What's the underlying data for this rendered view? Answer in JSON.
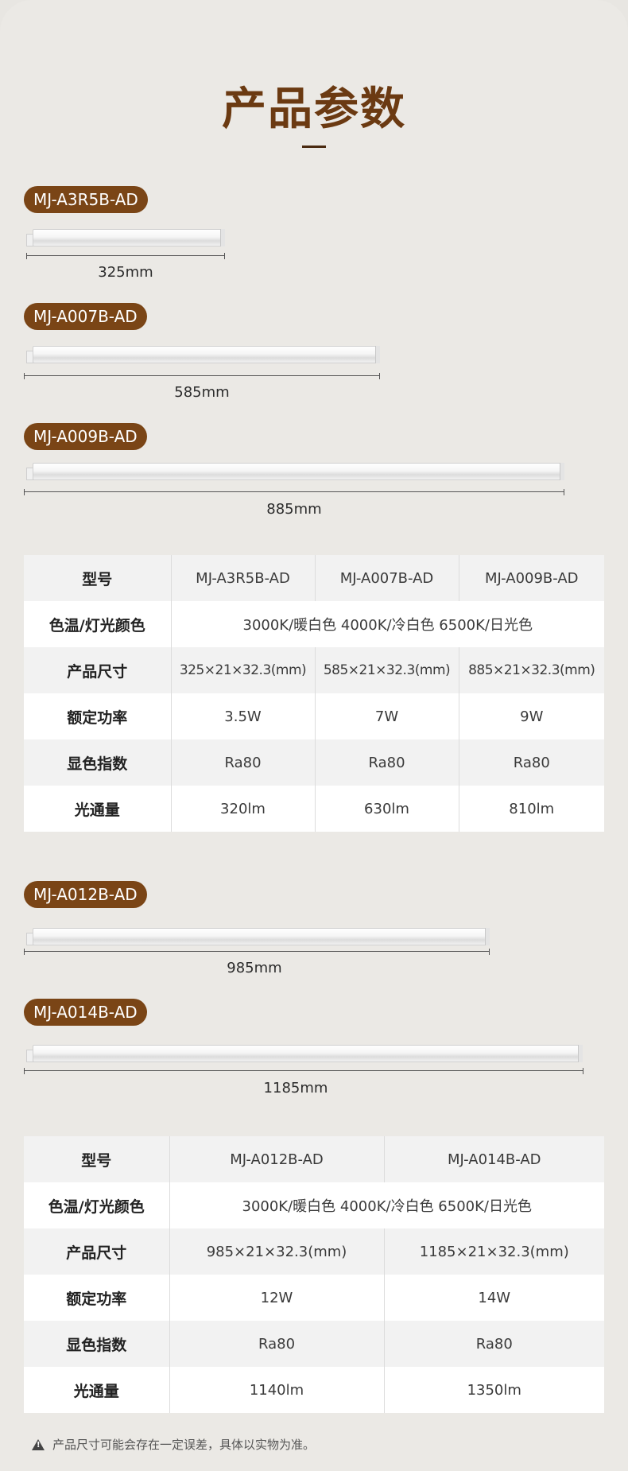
{
  "title": "产品参数",
  "products_a": [
    {
      "model": "MJ-A3R5B-AD",
      "length": "325mm"
    },
    {
      "model": "MJ-A007B-AD",
      "length": "585mm"
    },
    {
      "model": "MJ-A009B-AD",
      "length": "885mm"
    }
  ],
  "table_a": {
    "rows": [
      {
        "label": "型号",
        "cells": [
          "MJ-A3R5B-AD",
          "MJ-A007B-AD",
          "MJ-A009B-AD"
        ]
      },
      {
        "label": "色温/灯光颜色",
        "span": "3000K/暖白色 4000K/冷白色 6500K/日光色"
      },
      {
        "label": "产品尺寸",
        "cells": [
          "325×21×32.3(mm)",
          "585×21×32.3(mm)",
          "885×21×32.3(mm)"
        ]
      },
      {
        "label": "额定功率",
        "cells": [
          "3.5W",
          "7W",
          "9W"
        ]
      },
      {
        "label": "显色指数",
        "cells": [
          "Ra80",
          "Ra80",
          "Ra80"
        ]
      },
      {
        "label": "光通量",
        "cells": [
          "320lm",
          "630lm",
          "810lm"
        ]
      }
    ]
  },
  "products_b": [
    {
      "model": "MJ-A012B-AD",
      "length": "985mm"
    },
    {
      "model": "MJ-A014B-AD",
      "length": "1185mm"
    }
  ],
  "table_b": {
    "rows": [
      {
        "label": "型号",
        "cells": [
          "MJ-A012B-AD",
          "MJ-A014B-AD"
        ]
      },
      {
        "label": "色温/灯光颜色",
        "span": "3000K/暖白色 4000K/冷白色 6500K/日光色"
      },
      {
        "label": "产品尺寸",
        "cells": [
          "985×21×32.3(mm)",
          "1185×21×32.3(mm)"
        ]
      },
      {
        "label": "额定功率",
        "cells": [
          "12W",
          "14W"
        ]
      },
      {
        "label": "显色指数",
        "cells": [
          "Ra80",
          "Ra80"
        ]
      },
      {
        "label": "光通量",
        "cells": [
          "1140lm",
          "1350lm"
        ]
      }
    ]
  },
  "note": "产品尺寸可能会存在一定误差，具体以实物为准。",
  "colors": {
    "accent": "#7a4516",
    "title": "#6b3a12"
  }
}
